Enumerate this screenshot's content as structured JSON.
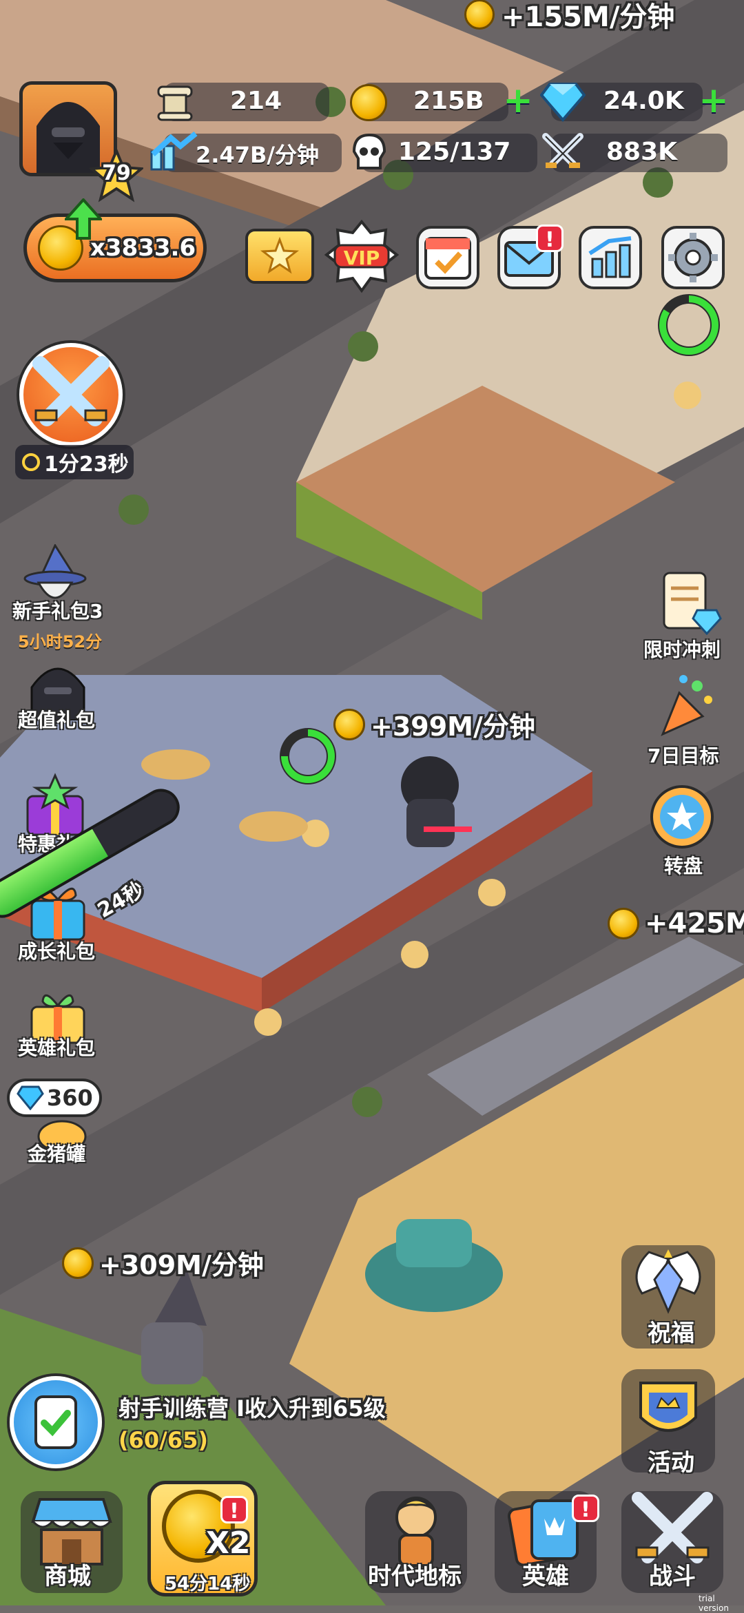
{
  "top_income": "+155M/分钟",
  "player": {
    "level": "79"
  },
  "resources": {
    "scroll_count": "214",
    "coins": "215B",
    "gems": "24.0K",
    "income_rate": "2.47B/分钟",
    "population": "125/137",
    "power": "883K"
  },
  "multiplier": "x3833.6",
  "top_buttons": [
    "pass-ticket-icon",
    "vip-icon",
    "calendar-icon",
    "mail-icon",
    "stats-icon",
    "settings-icon"
  ],
  "vip_label": "VIP",
  "battle_timer": "1分23秒",
  "left_menu": [
    {
      "label": "新手礼包3",
      "timer": "5小时52分"
    },
    {
      "label": "超值礼包"
    },
    {
      "label": "特惠礼包"
    },
    {
      "label": "成长礼包"
    },
    {
      "label": "英雄礼包"
    },
    {
      "label": "金猪罐",
      "gems": "360"
    }
  ],
  "progress_timer": "24秒",
  "right_menu": [
    {
      "label": "限时冲刺"
    },
    {
      "label": "7日目标"
    },
    {
      "label": "转盘"
    },
    {
      "label": "祝福"
    },
    {
      "label": "活动"
    }
  ],
  "floating_income": [
    "+399M/分钟",
    "+425M",
    "+309M/分钟"
  ],
  "task": {
    "title": "射手训练营 I收入升到65级",
    "progress": "(60/65)"
  },
  "bottom_nav": [
    {
      "label": "商城"
    },
    {
      "label": "54分14秒",
      "multiplier": "X2"
    },
    {
      "label": "时代地标"
    },
    {
      "label": "英雄"
    },
    {
      "label": "战斗"
    }
  ],
  "watermark": "trial version",
  "colors": {
    "accent_green": "#3adf3a",
    "badge_red": "#e62a3e",
    "coin_gold": "#f4b400",
    "task_progress": "#ffd54a"
  }
}
